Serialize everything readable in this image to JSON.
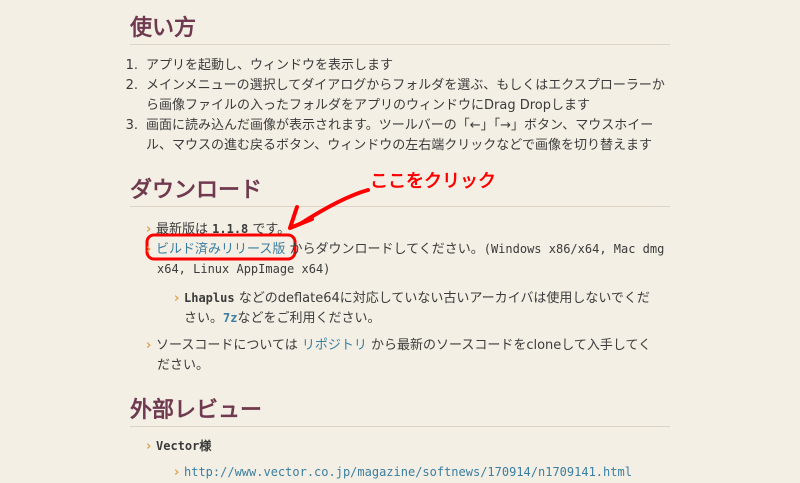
{
  "sec_usage": {
    "heading": "使い方",
    "items": [
      {
        "num": "1.",
        "lines": [
          "アプリを起動し、ウィンドウを表示します"
        ]
      },
      {
        "num": "2.",
        "lines": [
          "メインメニューの選択してダイアログからフォルダを選ぶ、もしくはエクスプローラーか",
          "ら画像ファイルの入ったフォルダをアプリのウィンドウにDrag Dropします"
        ]
      },
      {
        "num": "3.",
        "lines": [
          "画面に読み込んだ画像が表示されます。ツールバーの「←」「→」ボタン、マウスホイー",
          "ル、マウスの進む戻るボタン、ウィンドウの左右端クリックなどで画像を切り替えます"
        ]
      }
    ]
  },
  "sec_download": {
    "heading": "ダウンロード",
    "latest_prefix": "最新版は ",
    "latest_version": "1.1.8",
    "latest_suffix": " です。",
    "build_link": "ビルド済みリリース版",
    "build_text_1": " からダウンロードしてください。",
    "build_text_2": "(Windows x86/x64, Mac dmg",
    "build_text_3": "x64, Linux AppImage x64)",
    "lhaplus": "Lhaplus",
    "lhaplus_text_1": " などのdeflate64に対応していない古いアーカイバは使用しないでくだ",
    "lhaplus_text_2a": "さい。",
    "sevenzip": "7z",
    "lhaplus_text_2b": "などをご利用ください。",
    "source_text_1": "ソースコードについては ",
    "repo_link": "リポジトリ",
    "source_text_2": " から最新のソースコードをcloneして入手してく",
    "source_text_3": "ださい。"
  },
  "sec_review": {
    "heading": "外部レビュー",
    "vector_label": "Vector様",
    "vector_url": "http://www.vector.co.jp/magazine/softnews/170914/n1709141.html"
  },
  "annotation": {
    "text": "ここをクリック",
    "color": "#ff0000"
  }
}
